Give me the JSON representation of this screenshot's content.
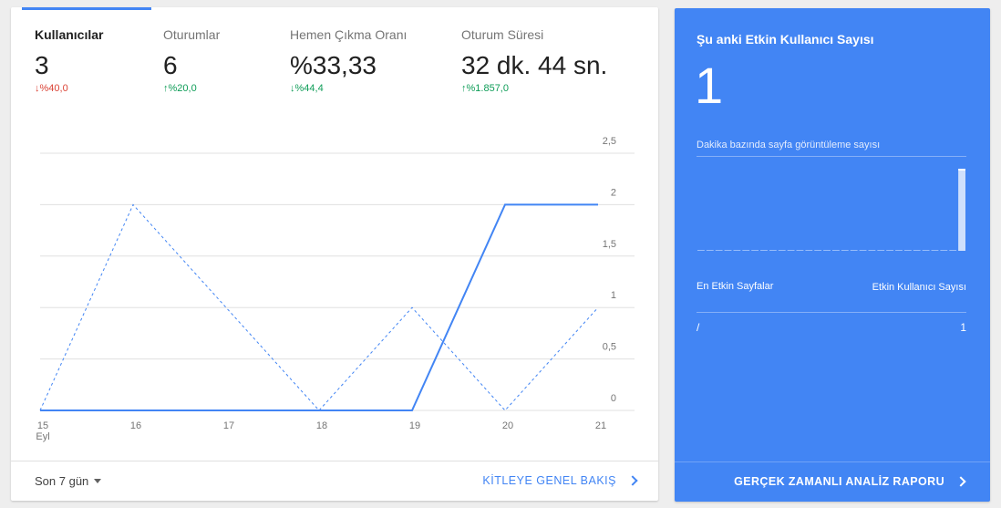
{
  "overview": {
    "metrics": [
      {
        "label": "Kullanıcılar",
        "value": "3",
        "change": "%40,0",
        "direction": "down",
        "status": "bad"
      },
      {
        "label": "Oturumlar",
        "value": "6",
        "change": "%20,0",
        "direction": "up",
        "status": "good"
      },
      {
        "label": "Hemen Çıkma Oranı",
        "value": "%33,33",
        "change": "%44,4",
        "direction": "down",
        "status": "good"
      },
      {
        "label": "Oturum Süresi",
        "value": "32 dk. 44 sn.",
        "change": "%1.857,0",
        "direction": "up",
        "status": "good"
      }
    ],
    "period_label": "Son 7 gün",
    "report_link": "KİTLEYE GENEL BAKIŞ"
  },
  "chart_data": {
    "type": "line",
    "categories": [
      "15",
      "16",
      "17",
      "18",
      "19",
      "20",
      "21"
    ],
    "x_sublabel": "Eyl",
    "series": [
      {
        "style": "solid",
        "values": [
          0,
          0,
          0,
          0,
          0,
          2,
          2
        ]
      },
      {
        "style": "dashed",
        "values": [
          0,
          2,
          1,
          0,
          1,
          0,
          1
        ]
      }
    ],
    "y_ticks": [
      "0",
      "0,5",
      "1",
      "1,5",
      "2",
      "2,5"
    ],
    "ylim": [
      0,
      2.5
    ],
    "grid": true,
    "y_axis_side": "right",
    "color": "#4285f4"
  },
  "realtime": {
    "title": "Şu anki Etkin Kullanıcı Sayısı",
    "active_users": "1",
    "pageviews_label": "Dakika bazında sayfa görüntüleme sayısı",
    "pageviews_per_minute": [
      0,
      0,
      0,
      0,
      0,
      0,
      0,
      0,
      0,
      0,
      0,
      0,
      0,
      0,
      0,
      0,
      0,
      0,
      0,
      0,
      0,
      0,
      0,
      0,
      0,
      0,
      0,
      0,
      0,
      1
    ],
    "table_header_pages": "En Etkin Sayfalar",
    "table_header_users": "Etkin Kullanıcı Sayısı",
    "rows": [
      {
        "page": "/",
        "users": "1"
      }
    ],
    "report_link": "GERÇEK ZAMANLI ANALİZ RAPORU"
  },
  "colors": {
    "accent": "#4285f4",
    "negative": "#db4437",
    "positive": "#0f9d58"
  }
}
